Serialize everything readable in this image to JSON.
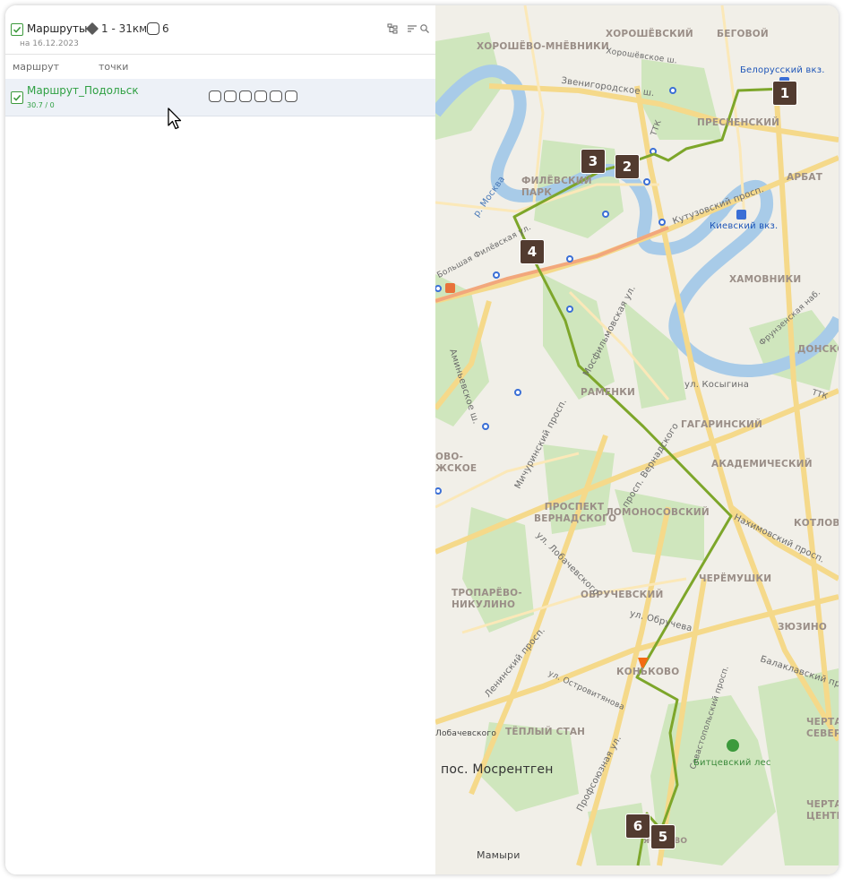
{
  "header": {
    "title": "Маршруты",
    "range": "1 - 31км",
    "count": "6",
    "date": "на 16.12.2023"
  },
  "columns": {
    "route": "маршрут",
    "points": "точки"
  },
  "route_row": {
    "name": "Маршрут_Подольск",
    "meta": "30.7 / 0",
    "points_count": 6
  },
  "map": {
    "districts": [
      "ХОРОШЁВО-МНЁВНИКИ",
      "ХОРОШЁВСКИЙ",
      "БЕГОВОЙ",
      "ПРЕСНЕНСКИЙ",
      "ФИЛЁВСКИЙ ПАРК",
      "АРБАТ",
      "ХАМОВНИКИ",
      "ДОНСКОЙ",
      "РАМЕНКИ",
      "ГАГАРИНСКИЙ",
      "АКАДЕМИЧЕСКИЙ",
      "ПРОСПЕКТ ВЕРНАДСКОГО",
      "ЛОМОНОСОВСКИЙ",
      "КОТЛОВКА",
      "ЧЕРЁМУШКИ",
      "ТРОПАРЁВО-НИКУЛИНО",
      "ОБРУЧЕВСКИЙ",
      "ЗЮЗИНО",
      "КОНЬКОВО",
      "ТЁПЛЫЙ СТАН",
      "ЧЕРТАНОВО СЕВЕРНОЕ",
      "ЧЕРТАНОВО ЦЕНТРАЛЬНОЕ",
      "ОВО-ЖСКОЕ",
      "ЯСЕНЕВО"
    ],
    "streets": [
      "Хорошёвское ш.",
      "Звенигородское ш.",
      "ТТК",
      "Кутузовский просп.",
      "р. Москва",
      "Большая Филёвская ул.",
      "Аминьевское ш.",
      "Мосфильмовская ул.",
      "ул. Косыгина",
      "Мичуринский просп.",
      "просп. Вернадского",
      "Нахимовский просп.",
      "ул. Лобачевского",
      "ул. Обручева",
      "Балаклавский просп.",
      "Ленинский просп.",
      "ул. Островитянова",
      "Профсоюзная ул.",
      "Севастопольский просп.",
      "Фрунзенская наб.",
      "ТТК"
    ],
    "stations": [
      "Белорусский вкз.",
      "Киевский вкз."
    ],
    "places": [
      "пос. Мосрентген",
      "Мамыри",
      "Битцевский лес",
      "Лобачевского"
    ],
    "markers": [
      "1",
      "2",
      "3",
      "4",
      "5",
      "6"
    ],
    "route_color": "#7da62a",
    "marker_color": "#523b30"
  },
  "colors": {
    "accent": "#2fa043",
    "row_selected": "#edf1f7"
  }
}
